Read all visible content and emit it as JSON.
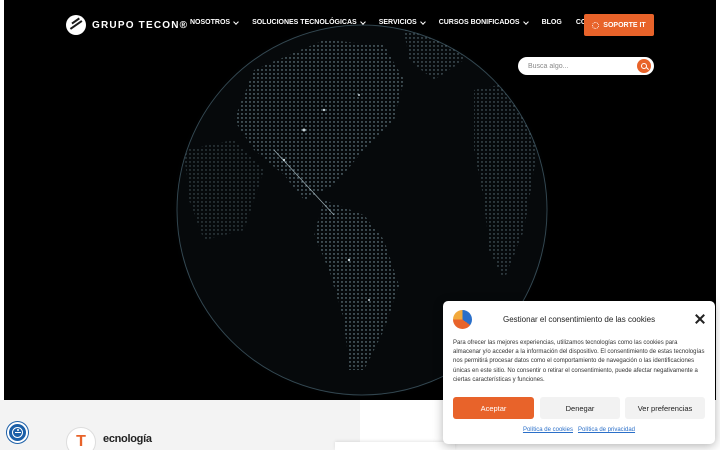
{
  "header": {
    "logo_text": "GRUPO TECON®",
    "nav": [
      {
        "label": "NOSOTROS",
        "has_dropdown": true
      },
      {
        "label": "SOLUCIONES TECNOLÓGICAS",
        "has_dropdown": true
      },
      {
        "label": "SERVICIOS",
        "has_dropdown": true
      },
      {
        "label": "CURSOS BONIFICADOS",
        "has_dropdown": true
      },
      {
        "label": "BLOG",
        "has_dropdown": false
      },
      {
        "label": "CONTACTO",
        "has_dropdown": false
      }
    ],
    "support_button": "SOPORTE IT"
  },
  "search": {
    "placeholder": "Busca algo..."
  },
  "section": {
    "badge_letter": "T",
    "heading_partial": "ecnología"
  },
  "cookie_modal": {
    "title": "Gestionar el consentimiento de las cookies",
    "body": "Para ofrecer las mejores experiencias, utilizamos tecnologías como las cookies para almacenar y/o acceder a la información del dispositivo. El consentimiento de estas tecnologías nos permitirá procesar datos como el comportamiento de navegación o las identificaciones únicas en este sitio. No consentir o retirar el consentimiento, puede afectar negativamente a ciertas características y funciones.",
    "accept": "Aceptar",
    "deny": "Denegar",
    "preferences": "Ver preferencias",
    "links": [
      "Política de cookies",
      "Política de privacidad"
    ]
  },
  "colors": {
    "accent": "#e8632a",
    "accessibility": "#1b5fa8",
    "link": "#2a6fc9",
    "hero_bg": "#000000"
  },
  "icons": [
    "logo-mark-icon",
    "chevron-down-icon",
    "gear-icon",
    "search-icon",
    "accessibility-icon",
    "close-icon",
    "cookie-logo-icon"
  ]
}
